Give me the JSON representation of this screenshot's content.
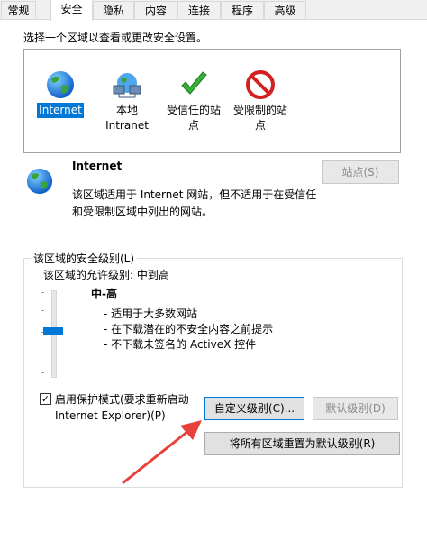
{
  "tabs": [
    "常规",
    "安全",
    "隐私",
    "内容",
    "连接",
    "程序",
    "高级"
  ],
  "active_tab": "安全",
  "instruction": "选择一个区域以查看或更改安全设置。",
  "zones": [
    {
      "label": "Internet",
      "icon": "globe-icon"
    },
    {
      "label": "本地\nIntranet",
      "icon": "network-icon"
    },
    {
      "label": "受信任的站\n点",
      "icon": "checkmark-icon"
    },
    {
      "label": "受限制的站\n点",
      "icon": "restricted-icon"
    }
  ],
  "selected_zone": "Internet",
  "detail": {
    "title": "Internet",
    "description": "该区域适用于 Internet 网站，但不适用于在受信任\n和受限制区域中列出的网站。",
    "sites_button": "站点(S)"
  },
  "security_level": {
    "group_label": "该区域的安全级别(L)",
    "allowed_levels": "该区域的允许级别: 中到高",
    "level_name": "中-高",
    "bullets": [
      "- 适用于大多数网站",
      "- 在下载潜在的不安全内容之前提示",
      "- 不下载未签名的 ActiveX 控件"
    ],
    "protected_mode_label": "启用保护模式(要求重新启动\nInternet Explorer)(P)",
    "protected_mode_checked": true,
    "custom_level_button": "自定义级别(C)...",
    "default_level_button": "默认级别(D)"
  },
  "reset_all_button": "将所有区域重置为默认级别(R)",
  "colors": {
    "accent": "#0078d7",
    "arrow": "#e8403a"
  }
}
